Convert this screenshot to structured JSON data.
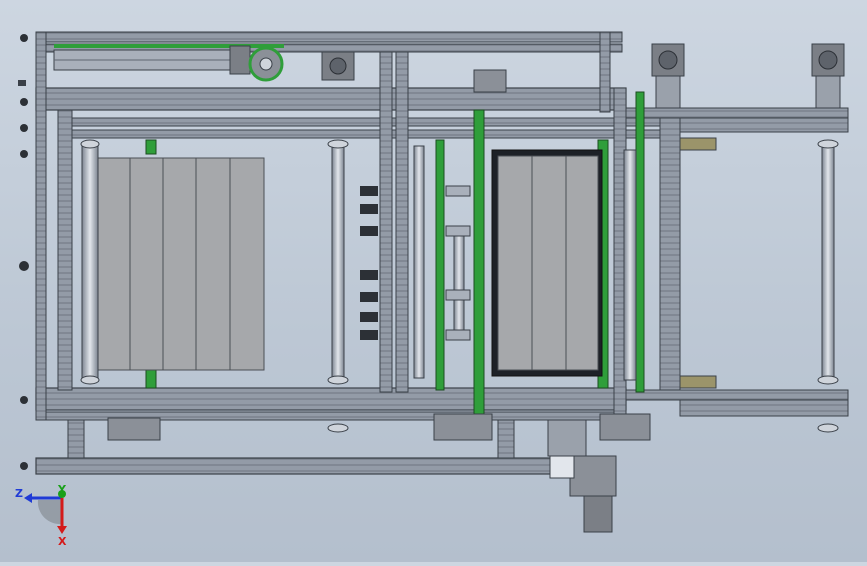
{
  "viewport": {
    "background_top": "#cdd6e1",
    "background_bottom": "#b4bfcd"
  },
  "colors": {
    "frame": "#8e96a2",
    "frame_dark": "#3a4048",
    "guide_green": "#2f9e3a",
    "panel": "#a6a8ab",
    "motor": "#7b7f86",
    "shaft": "#b9c0cb"
  },
  "triad": {
    "z_label": "Z",
    "y_label": "Y",
    "x_label": "X",
    "z_color": "#1f3bd6",
    "y_color": "#19a019",
    "x_color": "#d41a1a"
  }
}
